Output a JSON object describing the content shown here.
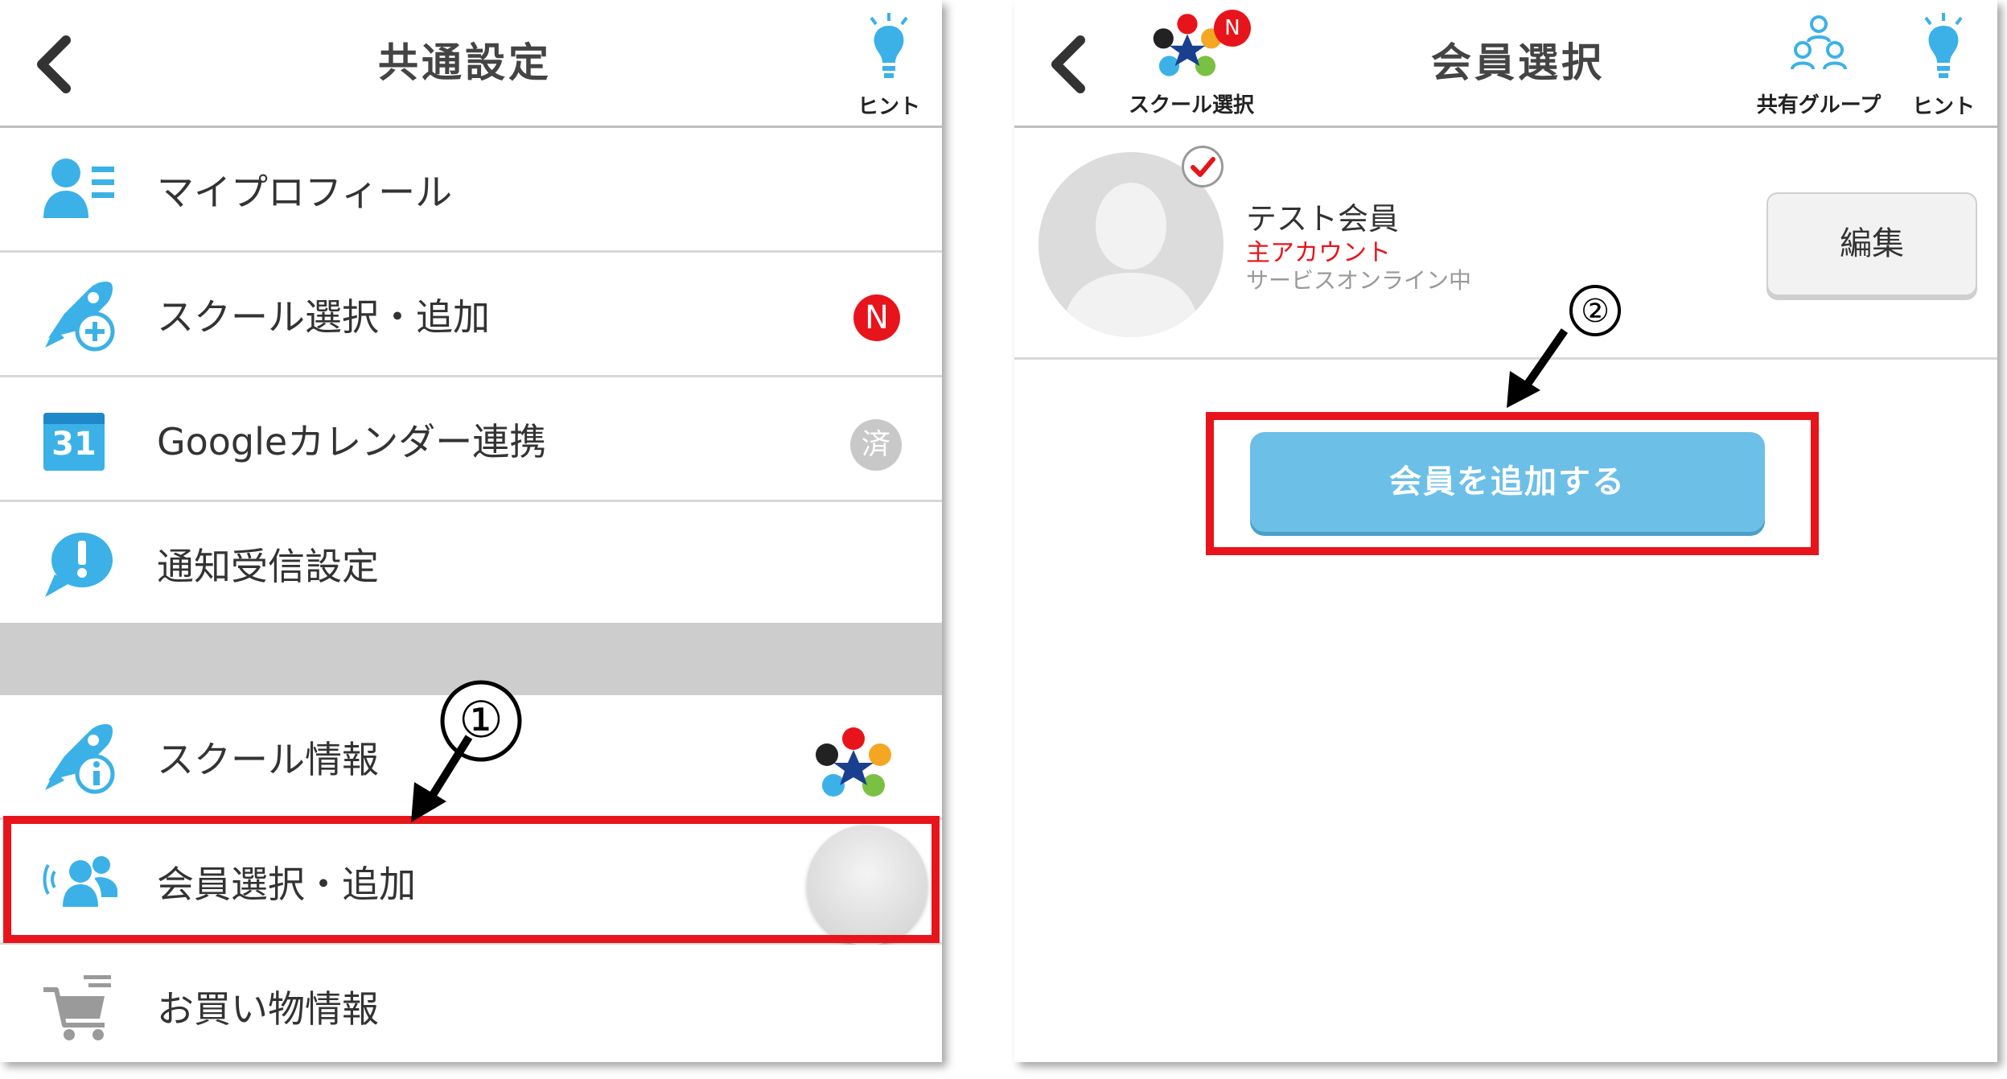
{
  "left": {
    "title": "共通設定",
    "hint_label": "ヒント",
    "menu": [
      {
        "label": "マイプロフィール"
      },
      {
        "label": "スクール選択・追加",
        "badge": "N"
      },
      {
        "label": "Googleカレンダー連携",
        "badge": "済",
        "calendar_day": "31"
      },
      {
        "label": "通知受信設定"
      },
      {
        "label": "スクール情報"
      },
      {
        "label": "会員選択・追加"
      },
      {
        "label": "お買い物情報"
      }
    ],
    "step_marker": "①"
  },
  "right": {
    "title": "会員選択",
    "school_select_label": "スクール選択",
    "school_badge": "N",
    "shared_group_label": "共有グループ",
    "hint_label": "ヒント",
    "member": {
      "name": "テスト会員",
      "role": "主アカウント",
      "status": "サービスオンライン中"
    },
    "edit_label": "編集",
    "add_member_label": "会員を追加する",
    "step_marker": "②"
  },
  "colors": {
    "accent_blue": "#3bb1e8",
    "button_blue": "#6cbfe7",
    "highlight_red": "#e8141b"
  }
}
